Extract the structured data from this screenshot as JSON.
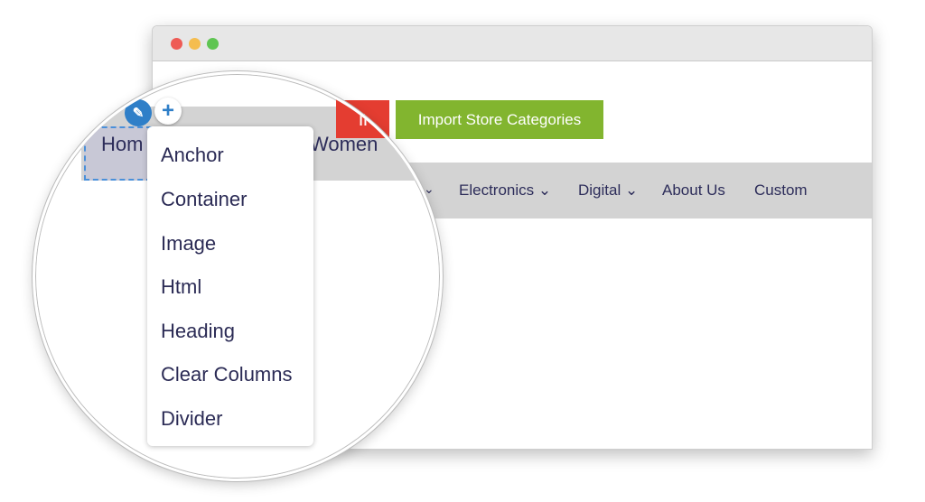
{
  "window": {
    "controls": {
      "close_color": "#ee5b55",
      "minimize_color": "#f5bd4f",
      "maximize_color": "#5fc552"
    }
  },
  "toolbar": {
    "red_button_partial": "ll",
    "import_label": "Import Store Categories",
    "red_color": "#e43d31",
    "green_color": "#82b52f"
  },
  "nav": {
    "items": [
      {
        "label": "Electronics ⌄"
      },
      {
        "label": "Digital ⌄"
      },
      {
        "label": "About Us"
      },
      {
        "label": "Custom"
      }
    ],
    "partial_chevron": "⌄"
  },
  "magnifier": {
    "nav_partial_home": "Hom",
    "nav_partial_women": "Women",
    "add_menu": {
      "items": [
        "Anchor",
        "Container",
        "Image",
        "Html",
        "Heading",
        "Clear Columns",
        "Divider"
      ]
    }
  }
}
